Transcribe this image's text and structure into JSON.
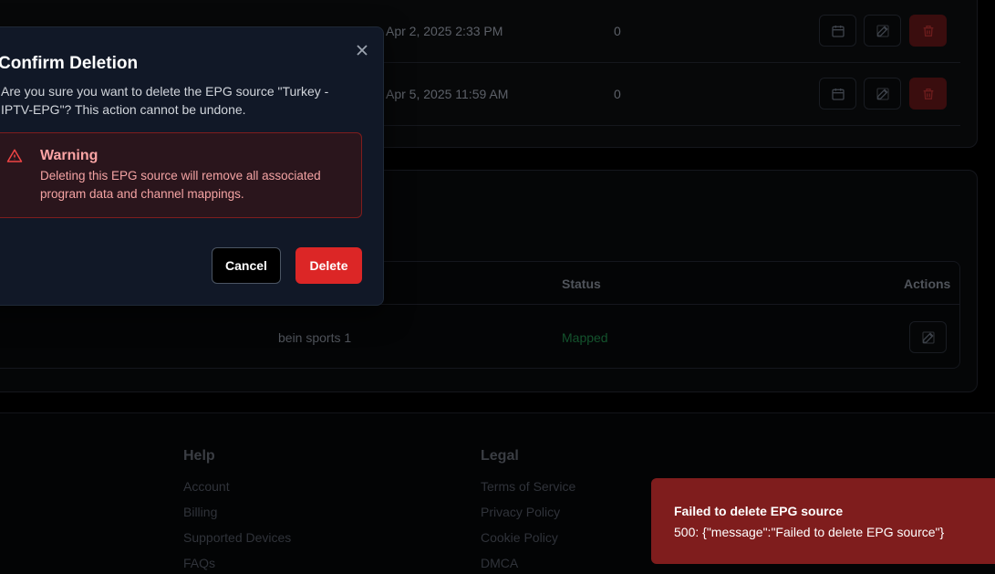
{
  "sources_table": {
    "rows": [
      {
        "date": "Apr 2, 2025 2:33 PM",
        "count": "0"
      },
      {
        "date": "Apr 5, 2025 11:59 AM",
        "count": "0"
      }
    ]
  },
  "mapping_table": {
    "headers": {
      "status": "Status",
      "actions": "Actions"
    },
    "rows": [
      {
        "channel": "bein sports 1",
        "status": "Mapped"
      }
    ]
  },
  "footer": {
    "help": {
      "heading": "Help",
      "links": [
        "Account",
        "Billing",
        "Supported Devices",
        "FAQs"
      ]
    },
    "legal": {
      "heading": "Legal",
      "links": [
        "Terms of Service",
        "Privacy Policy",
        "Cookie Policy",
        "DMCA"
      ]
    }
  },
  "modal": {
    "title": "Confirm Deletion",
    "description": "Are you sure you want to delete the EPG source \"Turkey - IPTV-EPG\"? This action cannot be undone.",
    "warning": {
      "title": "Warning",
      "text": "Deleting this EPG source will remove all associated program data and channel mappings."
    },
    "cancel_label": "Cancel",
    "delete_label": "Delete"
  },
  "toast": {
    "title": "Failed to delete EPG source",
    "message": "500: {\"message\":\"Failed to delete EPG source\"}"
  },
  "colors": {
    "danger": "#dc2626",
    "toast_bg": "#7f1d1d",
    "modal_bg": "#111827",
    "mapped_status": "#14532d"
  },
  "icons": [
    "calendar-icon",
    "edit-icon",
    "trash-icon",
    "close-icon",
    "warning-icon"
  ]
}
